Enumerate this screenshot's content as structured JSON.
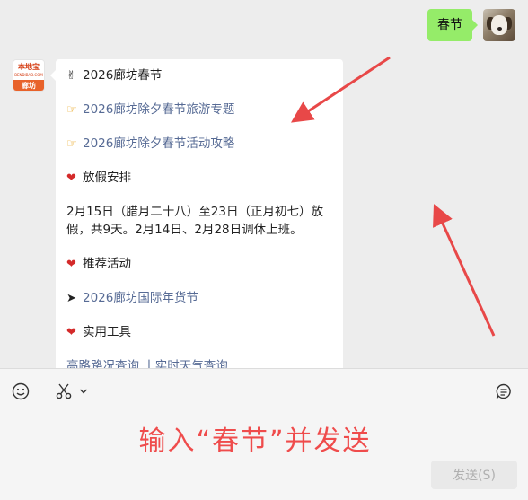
{
  "conversation": {
    "outgoing_message": "春节",
    "bot_avatar": {
      "brand": "廊坊",
      "logo_text": "本地宝",
      "logo_sub": "BENDIBAO.COM"
    },
    "reply": {
      "title": "2026廊坊春节",
      "links": [
        "2026廊坊除夕春节旅游专题",
        "2026廊坊除夕春节活动攻略"
      ],
      "holiday_heading": "放假安排",
      "holiday_text": "2月15日（腊月二十八）至23日（正月初七）放假，共9天。2月14日、2月28日调休上班。",
      "recommend_heading": "推荐活动",
      "recommend_link": "2026廊坊国际年货节",
      "tools_heading": "实用工具",
      "tools_links": "高路路况查询 丨实时天气查询"
    }
  },
  "input_bar": {
    "icons": [
      "emoji-icon",
      "scissors-icon",
      "chevron-down-icon",
      "chat-history-icon"
    ],
    "annotation": "输入“春节”并发送",
    "send_label": "发送(S)"
  },
  "colors": {
    "bubble_out": "#95ec69",
    "link": "#576b95",
    "annotation": "#ef4c4c",
    "heart": "#d42a2a"
  }
}
